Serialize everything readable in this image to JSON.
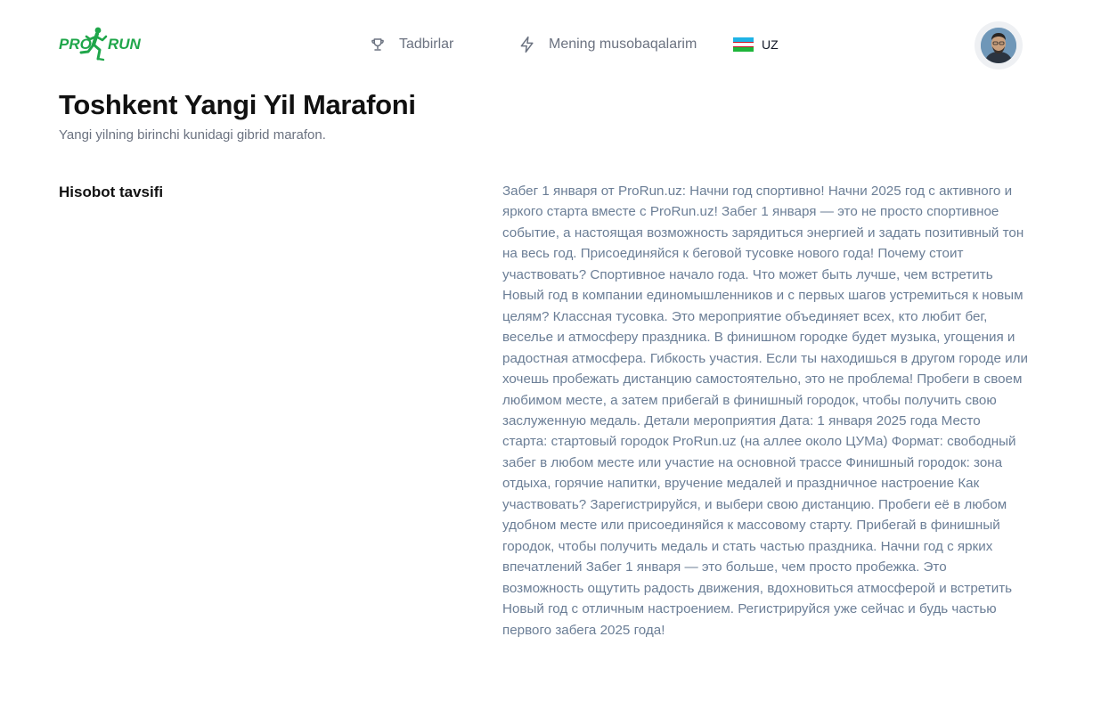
{
  "header": {
    "logo_text": "PRORUN",
    "nav": [
      {
        "label": "Tadbirlar",
        "icon": "trophy-icon"
      },
      {
        "label": "Mening musobaqalarim",
        "icon": "lightning-icon"
      }
    ],
    "language": {
      "code": "UZ",
      "flag": "uzbekistan-flag-icon"
    },
    "avatar": "user-avatar"
  },
  "event": {
    "title": "Toshkent Yangi Yil Marafoni",
    "subtitle": "Yangi yilning birinchi kunidagi gibrid marafon."
  },
  "report": {
    "label": "Hisobot tavsifi",
    "description": "Забег 1 января от ProRun.uz: Начни год спортивно! Начни 2025 год с активного и яркого старта вместе с ProRun.uz! Забег 1 января — это не просто спортивное событие, а настоящая возможность зарядиться энергией и задать позитивный тон на весь год. Присоединяйся к беговой тусовке нового года! Почему стоит участвовать? Спортивное начало года. Что может быть лучше, чем встретить Новый год в компании единомышленников и с первых шагов устремиться к новым целям? Классная тусовка. Это мероприятие объединяет всех, кто любит бег, веселье и атмосферу праздника. В финишном городке будет музыка, угощения и радостная атмосфера. Гибкость участия. Если ты находишься в другом городе или хочешь пробежать дистанцию самостоятельно, это не проблема! Пробеги в своем любимом месте, а затем прибегай в финишный городок, чтобы получить свою заслуженную медаль. Детали мероприятия Дата: 1 января 2025 года Место старта: стартовый городок ProRun.uz (на аллее около ЦУМа) Формат: свободный забег в любом месте или участие на основной трассе Финишный городок: зона отдыха, горячие напитки, вручение медалей и праздничное настроение Как участвовать? Зарегистрируйся, и выбери свою дистанцию. Пробеги её в любом удобном месте или присоединяйся к массовому старту. Прибегай в финишный городок, чтобы получить медаль и стать частью праздника. Начни год с ярких впечатлений Забег 1 января — это больше, чем просто пробежка. Это возможность ощутить радость движения, вдохновиться атмосферой и встретить Новый год с отличным настроением. Регистрируйся уже сейчас и будь частью первого забега 2025 года!"
  },
  "colors": {
    "brand_green": "#1fa64a",
    "title": "#111111",
    "muted": "#6b7280",
    "description": "#6b7e96"
  }
}
